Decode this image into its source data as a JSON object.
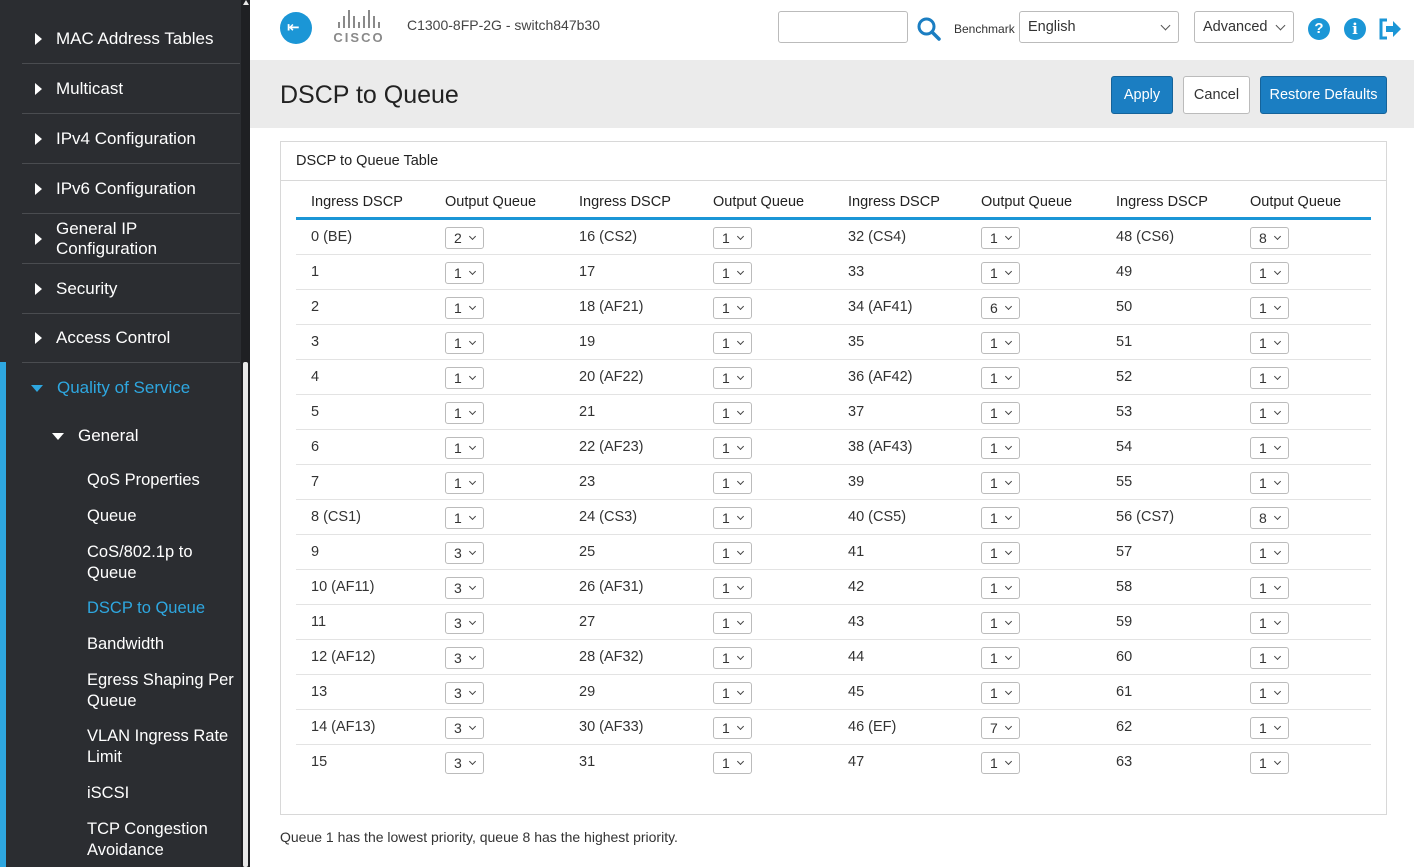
{
  "sidebar": {
    "items": [
      {
        "label": "MAC Address Tables"
      },
      {
        "label": "Multicast"
      },
      {
        "label": "IPv4 Configuration"
      },
      {
        "label": "IPv6 Configuration"
      },
      {
        "label": "General IP Configuration"
      },
      {
        "label": "Security"
      },
      {
        "label": "Access Control"
      }
    ],
    "qos_label": "Quality of Service",
    "general_label": "General",
    "sub_items": [
      {
        "label": "QoS Properties"
      },
      {
        "label": "Queue"
      },
      {
        "label": "CoS/802.1p to Queue"
      },
      {
        "label": "DSCP to Queue"
      },
      {
        "label": "Bandwidth"
      },
      {
        "label": "Egress Shaping Per Queue"
      },
      {
        "label": "VLAN Ingress Rate Limit"
      },
      {
        "label": "iSCSI"
      },
      {
        "label": "TCP Congestion Avoidance"
      }
    ]
  },
  "header": {
    "logo_word": "CISCO",
    "device_name": "C1300-8FP-2G - switch847b30",
    "search_value": "",
    "benchmark_label": "Benchmark",
    "language": "English",
    "mode": "Advanced",
    "help_icon": "?",
    "info_icon": "i"
  },
  "page": {
    "title": "DSCP to Queue",
    "apply_label": "Apply",
    "cancel_label": "Cancel",
    "restore_label": "Restore Defaults",
    "table_title": "DSCP to Queue Table",
    "col_dscp": "Ingress DSCP",
    "col_queue": "Output Queue",
    "footnote": "Queue 1 has the lowest priority, queue 8 has the highest priority."
  },
  "table": {
    "rows": [
      [
        {
          "d": "0 (BE)",
          "q": "2"
        },
        {
          "d": "16 (CS2)",
          "q": "1"
        },
        {
          "d": "32 (CS4)",
          "q": "1"
        },
        {
          "d": "48 (CS6)",
          "q": "8"
        }
      ],
      [
        {
          "d": "1",
          "q": "1"
        },
        {
          "d": "17",
          "q": "1"
        },
        {
          "d": "33",
          "q": "1"
        },
        {
          "d": "49",
          "q": "1"
        }
      ],
      [
        {
          "d": "2",
          "q": "1"
        },
        {
          "d": "18 (AF21)",
          "q": "1"
        },
        {
          "d": "34 (AF41)",
          "q": "6"
        },
        {
          "d": "50",
          "q": "1"
        }
      ],
      [
        {
          "d": "3",
          "q": "1"
        },
        {
          "d": "19",
          "q": "1"
        },
        {
          "d": "35",
          "q": "1"
        },
        {
          "d": "51",
          "q": "1"
        }
      ],
      [
        {
          "d": "4",
          "q": "1"
        },
        {
          "d": "20 (AF22)",
          "q": "1"
        },
        {
          "d": "36 (AF42)",
          "q": "1"
        },
        {
          "d": "52",
          "q": "1"
        }
      ],
      [
        {
          "d": "5",
          "q": "1"
        },
        {
          "d": "21",
          "q": "1"
        },
        {
          "d": "37",
          "q": "1"
        },
        {
          "d": "53",
          "q": "1"
        }
      ],
      [
        {
          "d": "6",
          "q": "1"
        },
        {
          "d": "22 (AF23)",
          "q": "1"
        },
        {
          "d": "38 (AF43)",
          "q": "1"
        },
        {
          "d": "54",
          "q": "1"
        }
      ],
      [
        {
          "d": "7",
          "q": "1"
        },
        {
          "d": "23",
          "q": "1"
        },
        {
          "d": "39",
          "q": "1"
        },
        {
          "d": "55",
          "q": "1"
        }
      ],
      [
        {
          "d": "8 (CS1)",
          "q": "1"
        },
        {
          "d": "24 (CS3)",
          "q": "1"
        },
        {
          "d": "40 (CS5)",
          "q": "1"
        },
        {
          "d": "56 (CS7)",
          "q": "8"
        }
      ],
      [
        {
          "d": "9",
          "q": "3"
        },
        {
          "d": "25",
          "q": "1"
        },
        {
          "d": "41",
          "q": "1"
        },
        {
          "d": "57",
          "q": "1"
        }
      ],
      [
        {
          "d": "10 (AF11)",
          "q": "3"
        },
        {
          "d": "26 (AF31)",
          "q": "1"
        },
        {
          "d": "42",
          "q": "1"
        },
        {
          "d": "58",
          "q": "1"
        }
      ],
      [
        {
          "d": "11",
          "q": "3"
        },
        {
          "d": "27",
          "q": "1"
        },
        {
          "d": "43",
          "q": "1"
        },
        {
          "d": "59",
          "q": "1"
        }
      ],
      [
        {
          "d": "12 (AF12)",
          "q": "3"
        },
        {
          "d": "28 (AF32)",
          "q": "1"
        },
        {
          "d": "44",
          "q": "1"
        },
        {
          "d": "60",
          "q": "1"
        }
      ],
      [
        {
          "d": "13",
          "q": "3"
        },
        {
          "d": "29",
          "q": "1"
        },
        {
          "d": "45",
          "q": "1"
        },
        {
          "d": "61",
          "q": "1"
        }
      ],
      [
        {
          "d": "14 (AF13)",
          "q": "3"
        },
        {
          "d": "30 (AF33)",
          "q": "1"
        },
        {
          "d": "46 (EF)",
          "q": "7"
        },
        {
          "d": "62",
          "q": "1"
        }
      ],
      [
        {
          "d": "15",
          "q": "3"
        },
        {
          "d": "31",
          "q": "1"
        },
        {
          "d": "47",
          "q": "1"
        },
        {
          "d": "63",
          "q": "1"
        }
      ]
    ]
  },
  "colors": {
    "accent": "#2ea7e0",
    "sidebar_bg": "#2b2d31",
    "primary_button": "#1b7ec2"
  }
}
